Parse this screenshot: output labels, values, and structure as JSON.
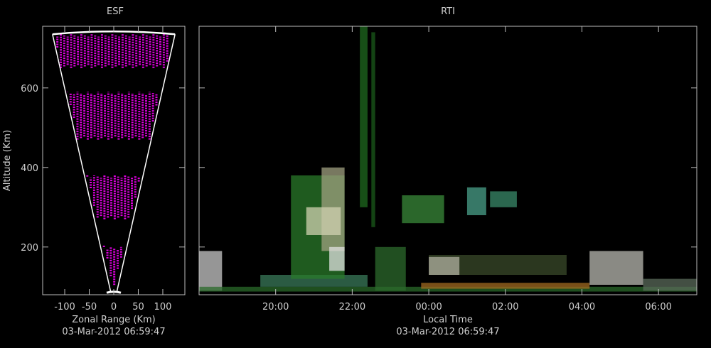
{
  "chart_data": [
    {
      "type": "scatter",
      "panel": "esf",
      "title": "ESF",
      "xlabel": "Zonal Range (Km)",
      "ylabel": "Altitude (Km)",
      "footer": "03-Mar-2012 06:59:47",
      "xlim": [
        -145,
        145
      ],
      "ylim": [
        80,
        755
      ],
      "x_ticks": [
        -100,
        -50,
        0,
        50,
        100
      ],
      "x_tick_labels": [
        "-100",
        "-50",
        "0",
        "50",
        "100"
      ],
      "y_ticks": [
        200,
        400,
        600
      ],
      "y_tick_labels": [
        "200",
        "400",
        "600"
      ],
      "fan_outline": {
        "apex_altitude": 85,
        "top_altitude": 735,
        "left_x_at_top": -125,
        "right_x_at_top": 125
      },
      "echo_color": "#e000e0",
      "echo_bands": [
        {
          "altitude_range": [
            85,
            200
          ],
          "x_range": [
            -20,
            20
          ]
        },
        {
          "altitude_range": [
            270,
            380
          ],
          "x_range": [
            -75,
            60
          ]
        },
        {
          "altitude_range": [
            470,
            590
          ],
          "x_range": [
            -95,
            90
          ]
        },
        {
          "altitude_range": [
            650,
            735
          ],
          "x_range": [
            -115,
            110
          ]
        }
      ]
    },
    {
      "type": "heatmap",
      "panel": "rti",
      "title": "RTI",
      "xlabel": "Local Time",
      "ylabel": "",
      "footer": "03-Mar-2012 06:59:47",
      "xlim_hours": [
        18.0,
        31.0
      ],
      "ylim": [
        80,
        755
      ],
      "x_ticks_hours": [
        20,
        22,
        24,
        26,
        28,
        30
      ],
      "x_tick_labels": [
        "20:00",
        "22:00",
        "00:00",
        "02:00",
        "04:00",
        "06:00"
      ],
      "y_ticks": [
        200,
        400,
        600
      ],
      "echoes": [
        {
          "t": [
            18.0,
            18.6
          ],
          "alt": [
            90,
            190
          ],
          "color": "#c8c8c8"
        },
        {
          "t": [
            18.0,
            31.0
          ],
          "alt": [
            88,
            100
          ],
          "color": "#2a6a2a"
        },
        {
          "t": [
            19.6,
            22.4
          ],
          "alt": [
            100,
            130
          ],
          "color": "#3a7a5a"
        },
        {
          "t": [
            20.4,
            21.8
          ],
          "alt": [
            120,
            380
          ],
          "color": "#2a7a2a"
        },
        {
          "t": [
            21.2,
            21.8
          ],
          "alt": [
            190,
            400
          ],
          "color": "#a0a080"
        },
        {
          "t": [
            20.8,
            21.7
          ],
          "alt": [
            230,
            300
          ],
          "color": "#d0d0b0"
        },
        {
          "t": [
            21.4,
            21.8
          ],
          "alt": [
            140,
            200
          ],
          "color": "#e0e0e0"
        },
        {
          "t": [
            22.2,
            22.4
          ],
          "alt": [
            300,
            755
          ],
          "color": "#1f6a1f"
        },
        {
          "t": [
            22.5,
            22.6
          ],
          "alt": [
            250,
            740
          ],
          "color": "#1a5a1a"
        },
        {
          "t": [
            22.6,
            23.4
          ],
          "alt": [
            90,
            200
          ],
          "color": "#2c6a2c"
        },
        {
          "t": [
            23.3,
            24.4
          ],
          "alt": [
            260,
            330
          ],
          "color": "#3a8a3a"
        },
        {
          "t": [
            23.8,
            28.2
          ],
          "alt": [
            95,
            110
          ],
          "color": "#a06a20"
        },
        {
          "t": [
            24.0,
            27.6
          ],
          "alt": [
            130,
            180
          ],
          "color": "#3a4a2a"
        },
        {
          "t": [
            24.0,
            24.8
          ],
          "alt": [
            130,
            175
          ],
          "color": "#b0b0a0"
        },
        {
          "t": [
            25.0,
            25.5
          ],
          "alt": [
            280,
            350
          ],
          "color": "#4aa08a"
        },
        {
          "t": [
            25.6,
            26.3
          ],
          "alt": [
            300,
            340
          ],
          "color": "#3a8a6a"
        },
        {
          "t": [
            28.2,
            29.6
          ],
          "alt": [
            105,
            190
          ],
          "color": "#b8b8b0"
        },
        {
          "t": [
            29.6,
            31.0
          ],
          "alt": [
            90,
            120
          ],
          "color": "#5a6a5a"
        }
      ]
    }
  ]
}
